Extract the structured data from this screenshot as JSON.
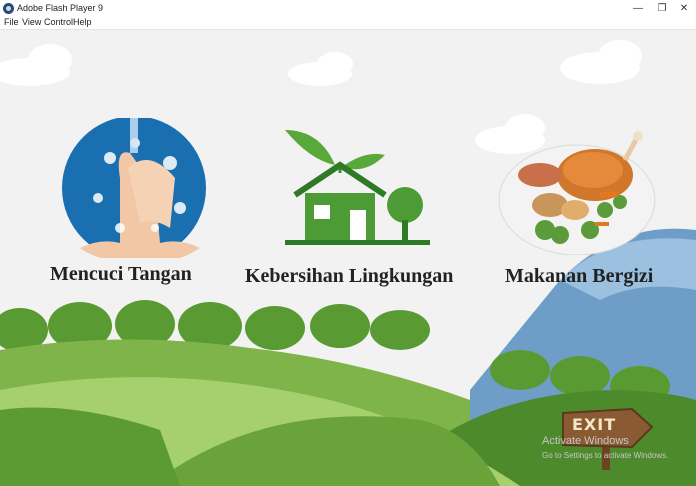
{
  "window": {
    "title": "Adobe Flash Player 9"
  },
  "menu": [
    "File",
    "View",
    "Control",
    "Help"
  ],
  "buttons": {
    "mencuci": "Mencuci Tangan",
    "kebersihan": "Kebersihan Lingkungan",
    "makanan": "Makanan Bergizi",
    "exit": "EXIT"
  },
  "watermark": {
    "line1": "Activate Windows",
    "line2": "Go to Settings to activate Windows."
  },
  "colors": {
    "hillDark": "#4d8a2c",
    "hillMid": "#7fb44a",
    "hillLight": "#a6cf6e",
    "mountain": "#6e9ec8",
    "houseGreen": "#3d8f2c"
  }
}
